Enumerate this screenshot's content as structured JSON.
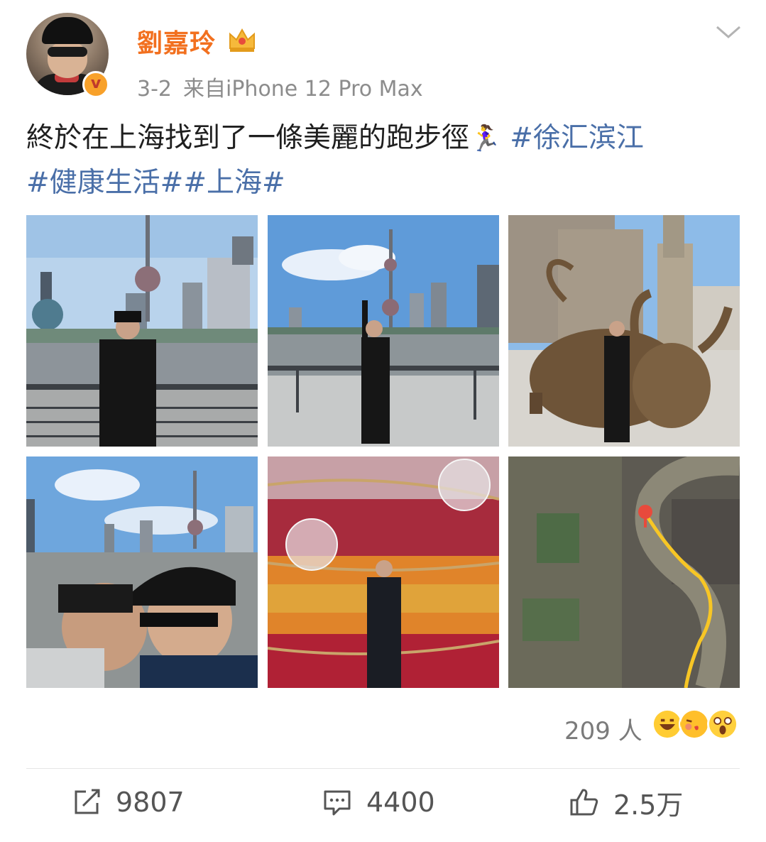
{
  "post": {
    "author": {
      "name": "劉嘉玲",
      "avatar_icon": "avatar-photo",
      "verified_icon": "verified-v-badge",
      "verified_mark": "v",
      "member_icon": "crown-icon"
    },
    "date": "3-2",
    "source": "来自iPhone 12 Pro Max",
    "text": {
      "main": "終於在上海找到了一條美麗的跑步徑",
      "emoji": "🏃‍♀️",
      "tag1": "#徐汇滨江",
      "tag2": "#健康生活#",
      "tag3": "#上海#"
    },
    "images": [
      {
        "name": "photo-river-pearl-tower",
        "icon": "photo"
      },
      {
        "name": "photo-waving-pearl-tower",
        "icon": "photo"
      },
      {
        "name": "photo-bund-bull",
        "icon": "photo"
      },
      {
        "name": "photo-selfie-skyline",
        "icon": "photo"
      },
      {
        "name": "photo-flower-wall",
        "icon": "photo"
      },
      {
        "name": "photo-running-route-map",
        "icon": "photo"
      }
    ],
    "reactions": {
      "count_text": "209 人",
      "emojis": [
        "grin-emoji",
        "kiss-emoji",
        "shocked-emoji"
      ]
    },
    "actions": {
      "repost": "9807",
      "comment": "4400",
      "like": "2.5万"
    }
  },
  "colors": {
    "username": "#f2701f",
    "hashtag": "#4a6fa8",
    "meta": "#8c8c8c"
  }
}
